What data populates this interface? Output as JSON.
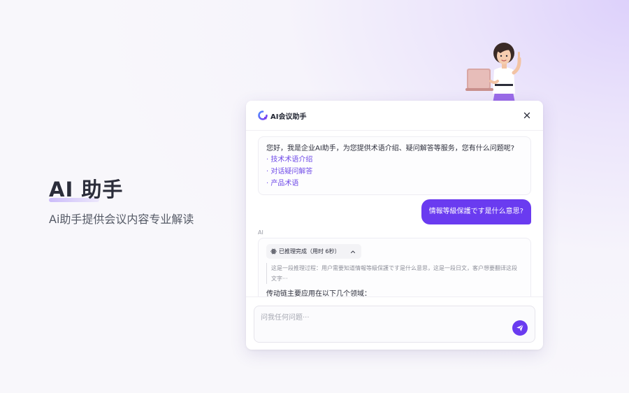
{
  "hero": {
    "title": "AI 助手",
    "subtitle": "Ai助手提供会议内容专业解读"
  },
  "panel": {
    "title": "AI会议助手",
    "logo_icon": "assistant-logo-icon",
    "close_icon": "close-icon"
  },
  "chat": {
    "greeting": "您好，我是企业AI助手，为您提供术语介绍、疑问解答等服务，您有什么问题呢?",
    "topics": [
      "· 技术术语介绍",
      "· 对话疑问解答",
      "· 产品术语"
    ],
    "user_message": "情報等級保護です是什么意思?",
    "ai_label": "AI",
    "reasoning": {
      "status": "已推理完成（用时 6秒）",
      "text": "这是一段推理过程：用户需要知道情報等級保護です是什么意思，这是一段日文，客户想要翻译这段文字···"
    },
    "answer_lead": "传动链主要应用在以下几个领域："
  },
  "input": {
    "placeholder": "问我任何问题···",
    "value": ""
  },
  "colors": {
    "accent": "#6a3bf0",
    "link": "#6f4ae8"
  }
}
